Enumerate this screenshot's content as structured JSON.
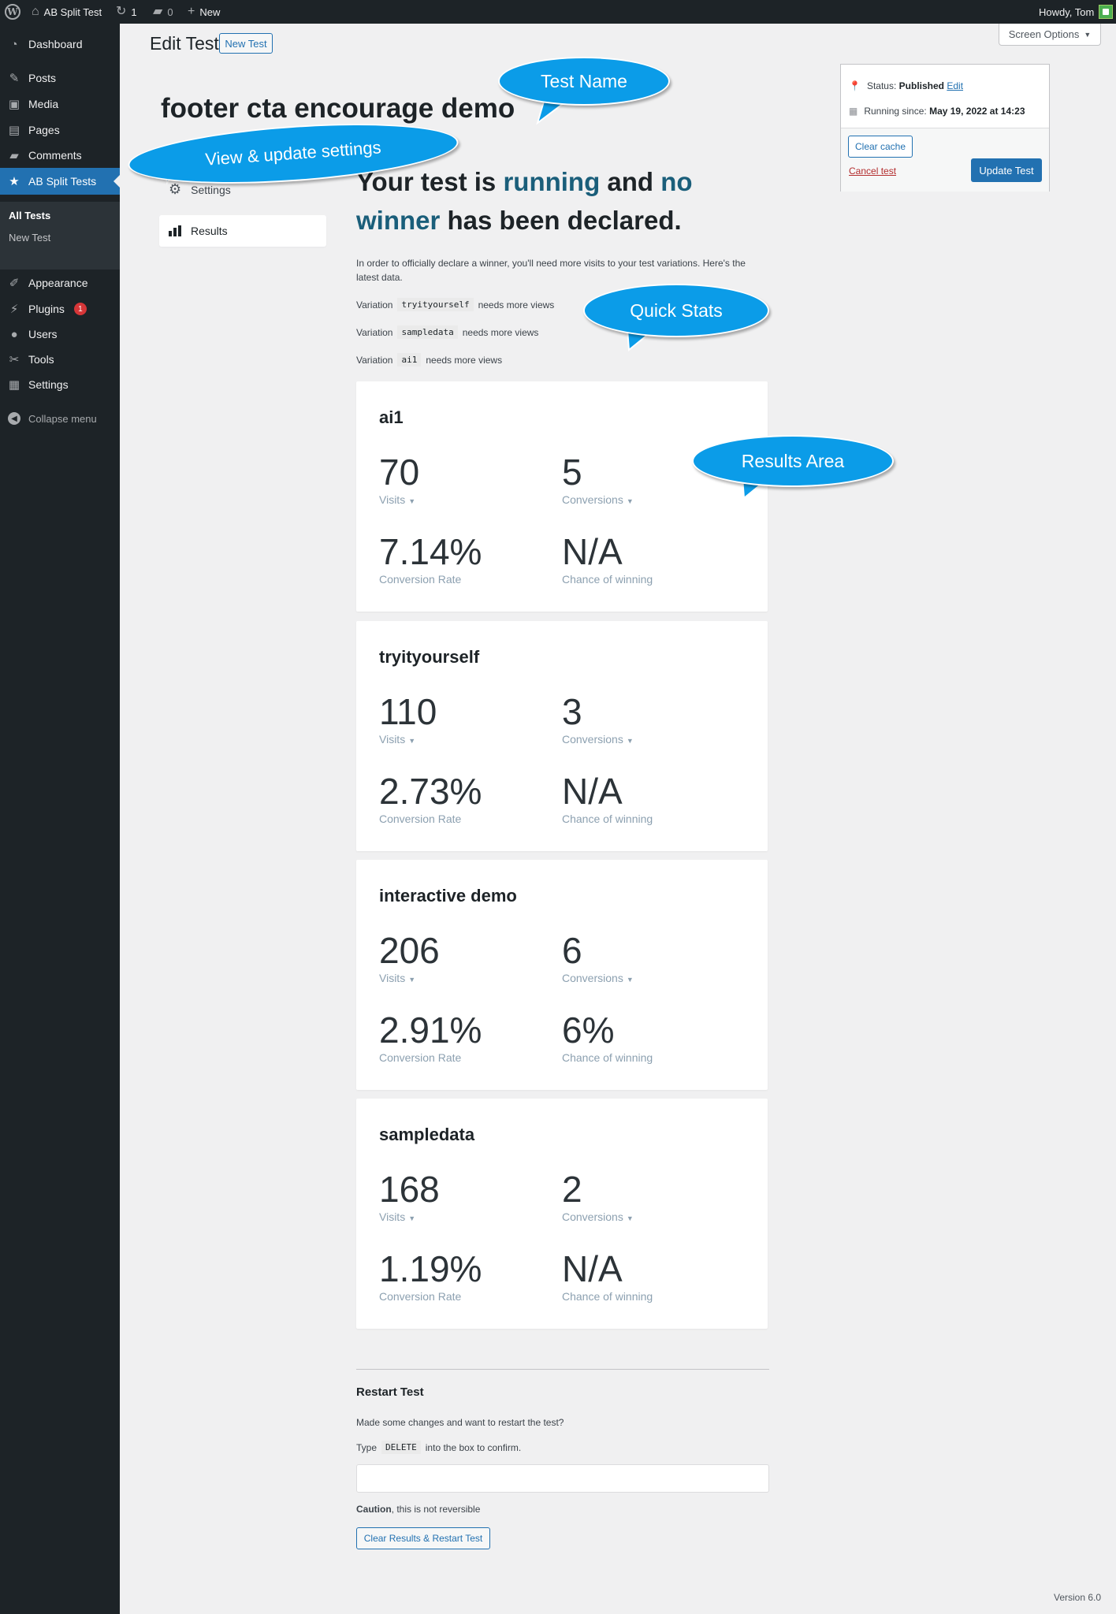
{
  "adminbar": {
    "logo_glyph": "W",
    "site_name": "AB Split Test",
    "updates_count": "1",
    "comments_count": "0",
    "new_label": "New",
    "greeting": "Howdy, Tom"
  },
  "sidebar": {
    "items": [
      {
        "label": "Dashboard",
        "icon": "dashboard-icon"
      },
      {
        "label": "Posts",
        "icon": "pin-icon"
      },
      {
        "label": "Media",
        "icon": "media-icon"
      },
      {
        "label": "Pages",
        "icon": "pages-icon"
      },
      {
        "label": "Comments",
        "icon": "comments-icon"
      },
      {
        "label": "AB Split Tests",
        "icon": "star-icon"
      },
      {
        "label": "Appearance",
        "icon": "brush-icon"
      },
      {
        "label": "Plugins",
        "icon": "plug-icon",
        "badge": "1"
      },
      {
        "label": "Users",
        "icon": "users-icon"
      },
      {
        "label": "Tools",
        "icon": "wrench-icon"
      },
      {
        "label": "Settings",
        "icon": "settings-icon"
      }
    ],
    "submenu": [
      "All Tests",
      "New Test"
    ],
    "collapse_label": "Collapse menu"
  },
  "header": {
    "title": "Edit Test",
    "new_button": "New Test",
    "screen_options": "Screen Options"
  },
  "test_name": "footer cta encourage demo",
  "left_nav": {
    "settings": "Settings",
    "results": "Results"
  },
  "status": {
    "status_label": "Status:",
    "status_value": "Published",
    "edit_link": "Edit",
    "running_label": "Running since:",
    "running_value": "May 19, 2022 at 14:23",
    "clear_cache": "Clear cache",
    "cancel_test": "Cancel test",
    "update_test": "Update Test"
  },
  "headline": {
    "part1": "Your test is ",
    "running": "running",
    "part2": " and ",
    "no": "no",
    "winner": "winner",
    "part3": " has been declared."
  },
  "intro": "In order to officially declare a winner, you'll need more visits to your test variations. Here's the latest data.",
  "quick_stats": [
    {
      "prefix": "Variation",
      "code": "tryityourself",
      "suffix": "needs more views"
    },
    {
      "prefix": "Variation",
      "code": "sampledata",
      "suffix": "needs more views"
    },
    {
      "prefix": "Variation",
      "code": "ai1",
      "suffix": "needs more views"
    }
  ],
  "stat_labels": {
    "visits": "Visits",
    "conversions": "Conversions",
    "conversion_rate": "Conversion Rate",
    "chance": "Chance of winning",
    "caret": "▼"
  },
  "results": [
    {
      "name": "ai1",
      "visits": "70",
      "conversions": "5",
      "rate": "7.14%",
      "chance": "N/A"
    },
    {
      "name": "tryityourself",
      "visits": "110",
      "conversions": "3",
      "rate": "2.73%",
      "chance": "N/A"
    },
    {
      "name": "interactive demo",
      "visits": "206",
      "conversions": "6",
      "rate": "2.91%",
      "chance": "6%"
    },
    {
      "name": "sampledata",
      "visits": "168",
      "conversions": "2",
      "rate": "1.19%",
      "chance": "N/A"
    }
  ],
  "restart": {
    "title": "Restart Test",
    "question": "Made some changes and want to restart the test?",
    "type_prefix": "Type",
    "type_code": "DELETE",
    "type_suffix": "into the box to confirm.",
    "caution_bold": "Caution",
    "caution_rest": ", this is not reversible",
    "button": "Clear Results & Restart Test"
  },
  "version": "Version 6.0",
  "annotations": {
    "test_name": "Test Name",
    "settings": "View & update settings",
    "quick_stats": "Quick Stats",
    "results_area": "Results Area"
  },
  "colors": {
    "accent": "#2271b1",
    "bubble": "#0b9ce8",
    "headline_accent": "#1a5e7a",
    "admin_bg": "#1d2327"
  }
}
